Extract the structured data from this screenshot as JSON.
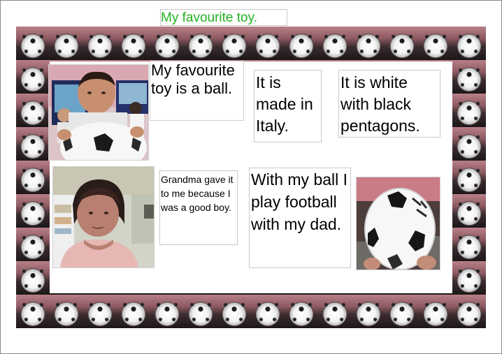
{
  "title": "My favourite toy.",
  "boxes": {
    "toy_ball": "My favourite toy is a ball.",
    "made_in": "It is made in Italy.",
    "colors": "It is white with black pentagons.",
    "grandma": "Grandma gave it to me because I was a good boy.",
    "play": "With my ball I play football with my dad."
  },
  "colors": {
    "title_text": "#22b222",
    "border_pink": "#b88088"
  }
}
